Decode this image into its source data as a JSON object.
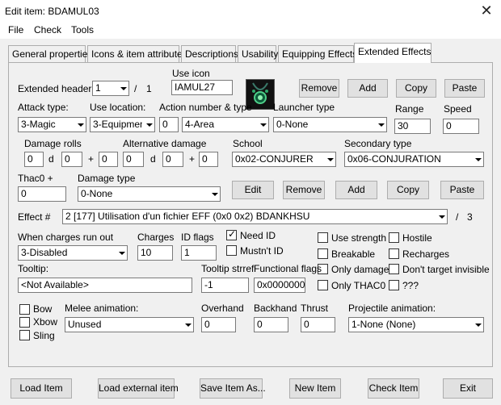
{
  "window": {
    "title": "Edit item: BDAMUL03"
  },
  "menu": [
    "File",
    "Check",
    "Tools"
  ],
  "tabs": [
    "General properties",
    "Icons & item attributes",
    "Descriptions",
    "Usability",
    "Equipping Effects",
    "Extended Effects"
  ],
  "active_tab": "Extended Effects",
  "header_row": {
    "extended_header_label": "Extended header:",
    "extended_header_value": "1",
    "slash": "/",
    "extended_header_total": "1",
    "use_icon_label": "Use icon",
    "use_icon_value": "IAMUL27",
    "remove": "Remove",
    "add": "Add",
    "copy": "Copy",
    "paste": "Paste"
  },
  "attack": {
    "attack_type_label": "Attack type:",
    "attack_type_value": "3-Magic",
    "use_location_label": "Use location:",
    "use_location_value": "3-Equipment",
    "action_label": "Action number & type",
    "action_number": "0",
    "action_type": "4-Area",
    "launcher_label": "Launcher type",
    "launcher_value": "0-None",
    "range_label": "Range",
    "range_value": "30",
    "speed_label": "Speed",
    "speed_value": "0"
  },
  "damage": {
    "rolls_label": "Damage rolls",
    "d": "d",
    "plus": "+",
    "roll_count": "0",
    "roll_dice": "0",
    "roll_bonus": "0",
    "alt_label": "Alternative damage",
    "alt_count": "0",
    "alt_dice": "0",
    "alt_bonus": "0",
    "school_label": "School",
    "school_value": "0x02-CONJURER",
    "secondary_label": "Secondary type",
    "secondary_value": "0x06-CONJURATION"
  },
  "thac0": {
    "thac0_label": "Thac0 +",
    "thac0_value": "0",
    "damage_type_label": "Damage type",
    "damage_type_value": "0-None",
    "edit": "Edit",
    "remove": "Remove",
    "add": "Add",
    "copy": "Copy",
    "paste": "Paste"
  },
  "effect": {
    "label": "Effect #",
    "value": "2 [177] Utilisation d'un fichier EFF (0x0 0x2) BDANKHSU",
    "slash": "/",
    "total": "3"
  },
  "charges": {
    "when_label": "When charges run out",
    "when_value": "3-Disabled",
    "charges_label": "Charges",
    "charges_value": "10",
    "id_flags_label": "ID flags",
    "id_flags_value": "1",
    "need_id": "Need ID",
    "mustnt_id": "Mustn't ID",
    "use_strength": "Use strength",
    "breakable": "Breakable",
    "only_damage": "Only damage",
    "only_thac0": "Only THAC0",
    "hostile": "Hostile",
    "recharges": "Recharges",
    "dont_target_invisible": "Don't target invisible",
    "unknown": "???"
  },
  "tooltip": {
    "label": "Tooltip:",
    "value": "<Not Available>",
    "strref_label": "Tooltip strref",
    "strref_value": "-1",
    "functional_label": "Functional flags",
    "functional_value": "0x00000000"
  },
  "animation": {
    "bow": "Bow",
    "xbow": "Xbow",
    "sling": "Sling",
    "melee_label": "Melee animation:",
    "melee_value": "Unused",
    "overhand_label": "Overhand",
    "overhand_value": "0",
    "backhand_label": "Backhand",
    "backhand_value": "0",
    "thrust_label": "Thrust",
    "thrust_value": "0",
    "projectile_label": "Projectile animation:",
    "projectile_value": "1-None (None)"
  },
  "bottom_buttons": [
    "Load Item",
    "Load external item",
    "Save Item As...",
    "New Item",
    "Check Item",
    "Exit"
  ]
}
